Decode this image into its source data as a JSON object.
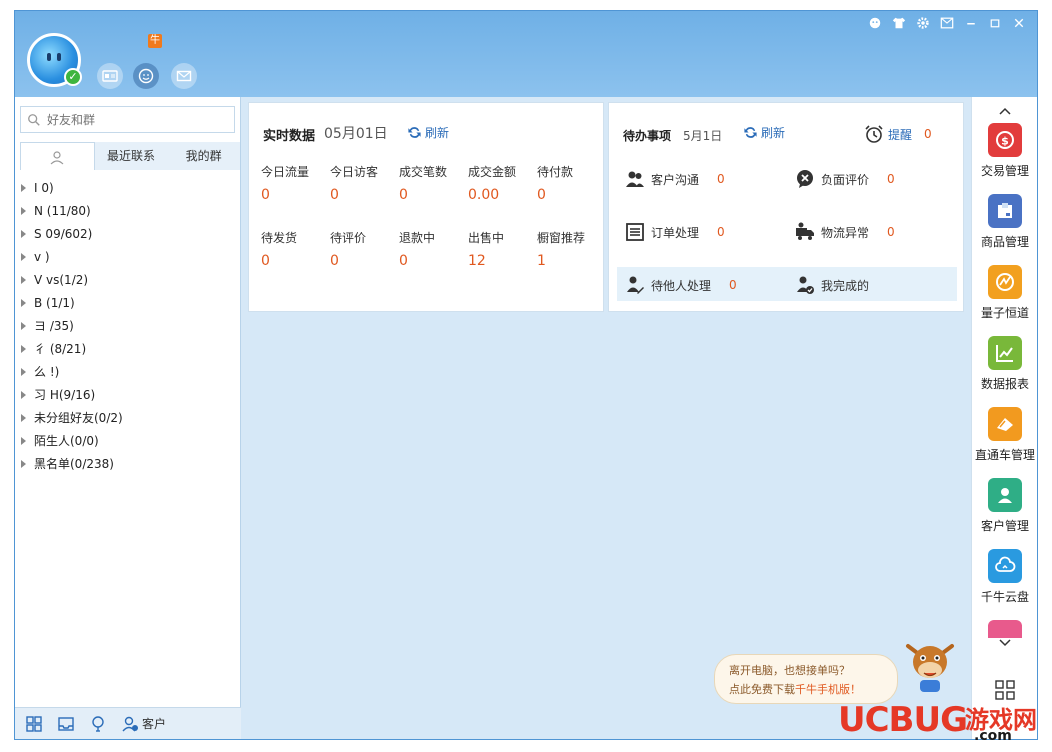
{
  "header": {
    "niu_badge": "牛"
  },
  "search": {
    "placeholder": "好友和群"
  },
  "tabs": [
    {
      "label": ""
    },
    {
      "label": "最近联系"
    },
    {
      "label": "我的群"
    }
  ],
  "groups": [
    {
      "label": "I 0)"
    },
    {
      "label": "N (11/80)"
    },
    {
      "label": "S 09/602)"
    },
    {
      "label": "v )"
    },
    {
      "label": "V vs(1/2)"
    },
    {
      "label": "B (1/1)"
    },
    {
      "label": "ヨ /35)"
    },
    {
      "label": "彳 (8/21)"
    },
    {
      "label": "么 !)"
    },
    {
      "label": "习 H(9/16)"
    },
    {
      "label": "未分组好友(0/2)"
    },
    {
      "label": "陌生人(0/0)"
    },
    {
      "label": "黑名单(0/238)"
    }
  ],
  "leftbar": {
    "customer_label": "客户"
  },
  "realtime": {
    "title": "实时数据",
    "date": "05月01日",
    "refresh": "刷新",
    "metrics": [
      {
        "label": "今日流量",
        "value": "0"
      },
      {
        "label": "今日访客",
        "value": "0"
      },
      {
        "label": "成交笔数",
        "value": "0"
      },
      {
        "label": "成交金额",
        "value": "0.00"
      },
      {
        "label": "待付款",
        "value": "0"
      },
      {
        "label": "待发货",
        "value": "0"
      },
      {
        "label": "待评价",
        "value": "0"
      },
      {
        "label": "退款中",
        "value": "0"
      },
      {
        "label": "出售中",
        "value": "12"
      },
      {
        "label": "橱窗推荐",
        "value": "1"
      }
    ]
  },
  "todo": {
    "title": "待办事项",
    "date": "5月1日",
    "refresh": "刷新",
    "remind_label": "提醒",
    "remind_count": "0",
    "items": [
      {
        "label": "客户沟通",
        "count": "0"
      },
      {
        "label": "负面评价",
        "count": "0"
      },
      {
        "label": "订单处理",
        "count": "0"
      },
      {
        "label": "物流异常",
        "count": "0"
      },
      {
        "label": "待他人处理",
        "count": "0"
      },
      {
        "label": "我完成的",
        "count": ""
      }
    ]
  },
  "apps": [
    {
      "label": "交易管理",
      "color": "#e23c3c"
    },
    {
      "label": "商品管理",
      "color": "#4a72c4"
    },
    {
      "label": "量子恒道",
      "color": "#f2a01f"
    },
    {
      "label": "数据报表",
      "color": "#79b83a"
    },
    {
      "label": "直通车管理",
      "color": "#f29a1f"
    },
    {
      "label": "客户管理",
      "color": "#2fae86"
    },
    {
      "label": "千牛云盘",
      "color": "#2a9ae0"
    }
  ],
  "promo": {
    "line1": "离开电脑，也想接单吗？",
    "line2_prefix": "点此免费下载",
    "line2_highlight": "千牛手机版！"
  },
  "watermark": {
    "brand": "UCBUG",
    "suffix": "游戏网",
    "domain": ".com"
  }
}
